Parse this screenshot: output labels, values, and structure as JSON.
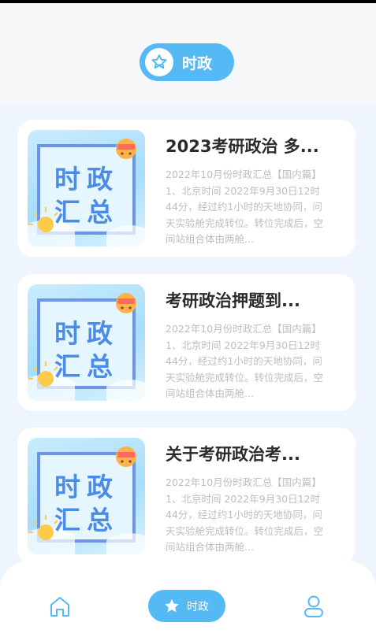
{
  "header": {
    "tab_label": "时政",
    "tab_icon": "star-icon"
  },
  "articles": [
    {
      "title": "2023考研政治 多...",
      "thumbnail": {
        "line1": "时政",
        "line2": "汇总"
      },
      "excerpt": "2022年10月份时政汇总【国内篇】1、北京时间 2022年9月30日12时44分，经过约1小时的天地协同，问天实验舱完成转位。转位完成后，空间站组合体由两舱..."
    },
    {
      "title": "考研政治押题到...",
      "thumbnail": {
        "line1": "时政",
        "line2": "汇总"
      },
      "excerpt": "2022年10月份时政汇总【国内篇】1、北京时间 2022年9月30日12时44分，经过约1小时的天地协同，问天实验舱完成转位。转位完成后，空间站组合体由两舱..."
    },
    {
      "title": "关于考研政治考...",
      "thumbnail": {
        "line1": "时政",
        "line2": "汇总"
      },
      "excerpt": "2022年10月份时政汇总【国内篇】1、北京时间 2022年9月30日12时44分，经过约1小时的天地协同，问天实验舱完成转位。转位完成后，空间站组合体由两舱..."
    }
  ],
  "bottom_nav": {
    "home_icon": "home-icon",
    "active_label": "时政",
    "active_icon": "star-icon",
    "profile_icon": "user-icon"
  },
  "colors": {
    "accent": "#55b9f5",
    "background": "#eef5fd",
    "header_bg": "#f6f7f9"
  }
}
